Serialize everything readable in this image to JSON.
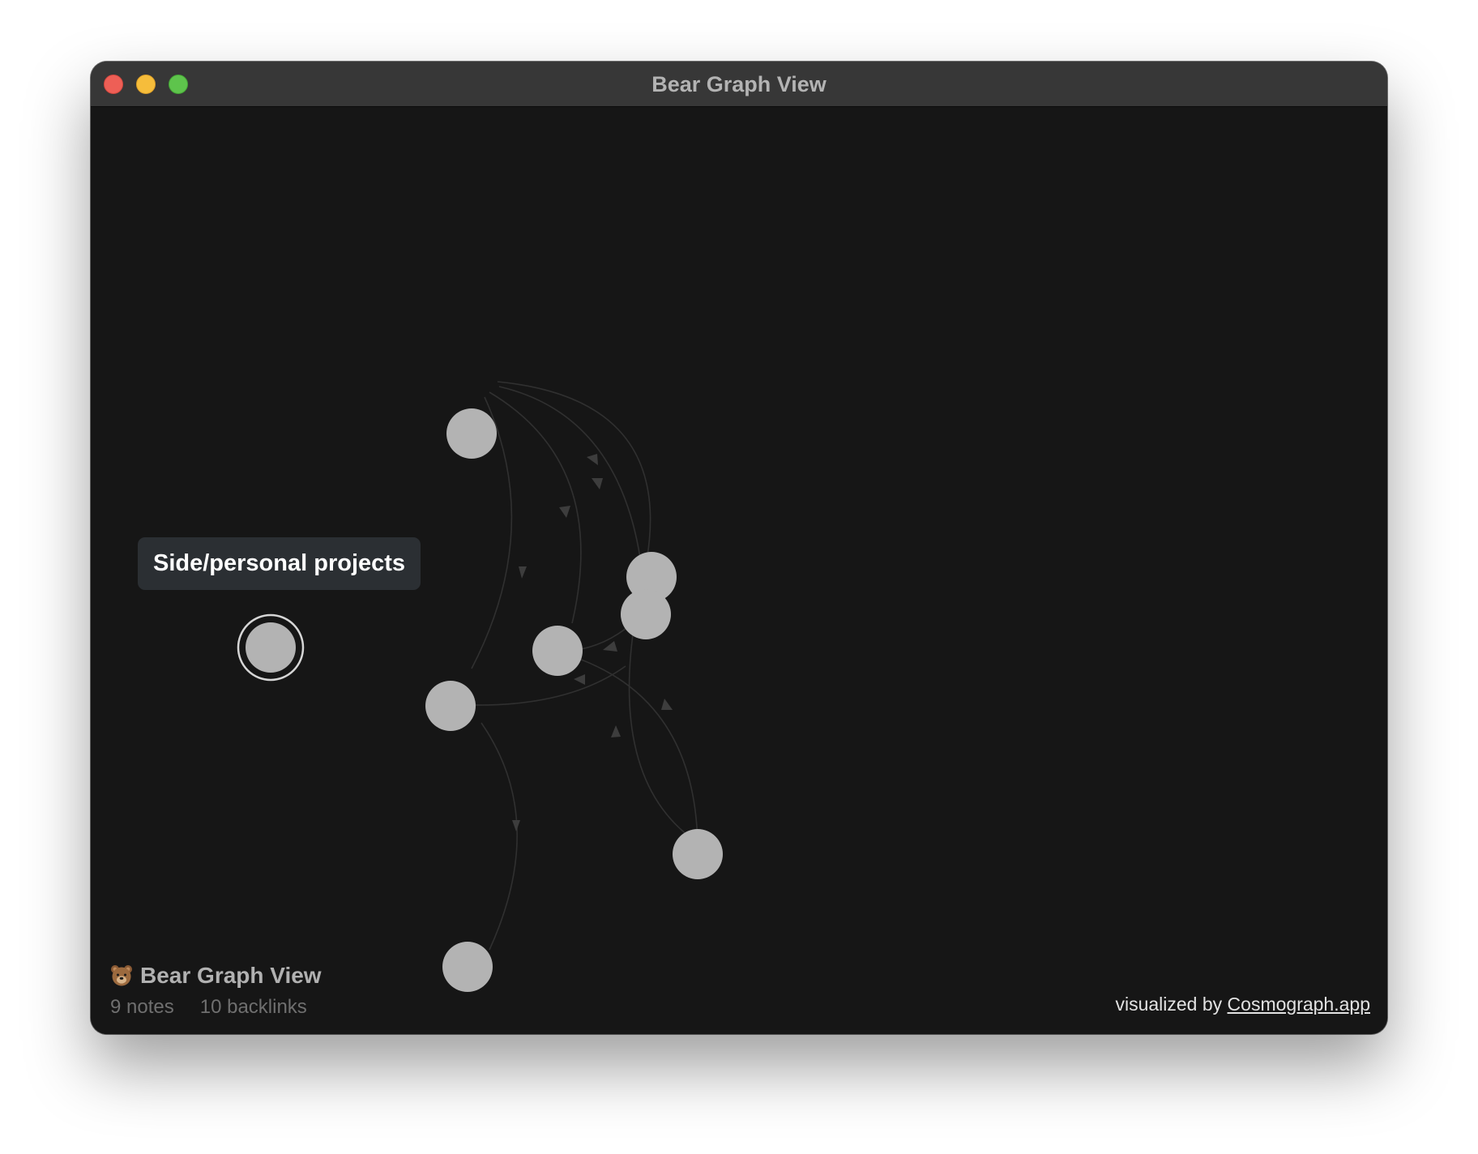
{
  "window": {
    "title": "Bear Graph View"
  },
  "graph": {
    "hovered_node_label": "Side/personal projects"
  },
  "footer": {
    "brand_icon": "bear-face-icon",
    "brand_title": "Bear Graph View",
    "notes_count": "9 notes",
    "backlinks_count": "10 backlinks",
    "credit_prefix": "visualized by",
    "credit_link": "Cosmograph.app"
  },
  "colors": {
    "background": "#161616",
    "titlebar": "#373737",
    "node": "#b3b3b3",
    "link": "#3a3a3a",
    "tooltip_bg": "#2b2f33"
  }
}
